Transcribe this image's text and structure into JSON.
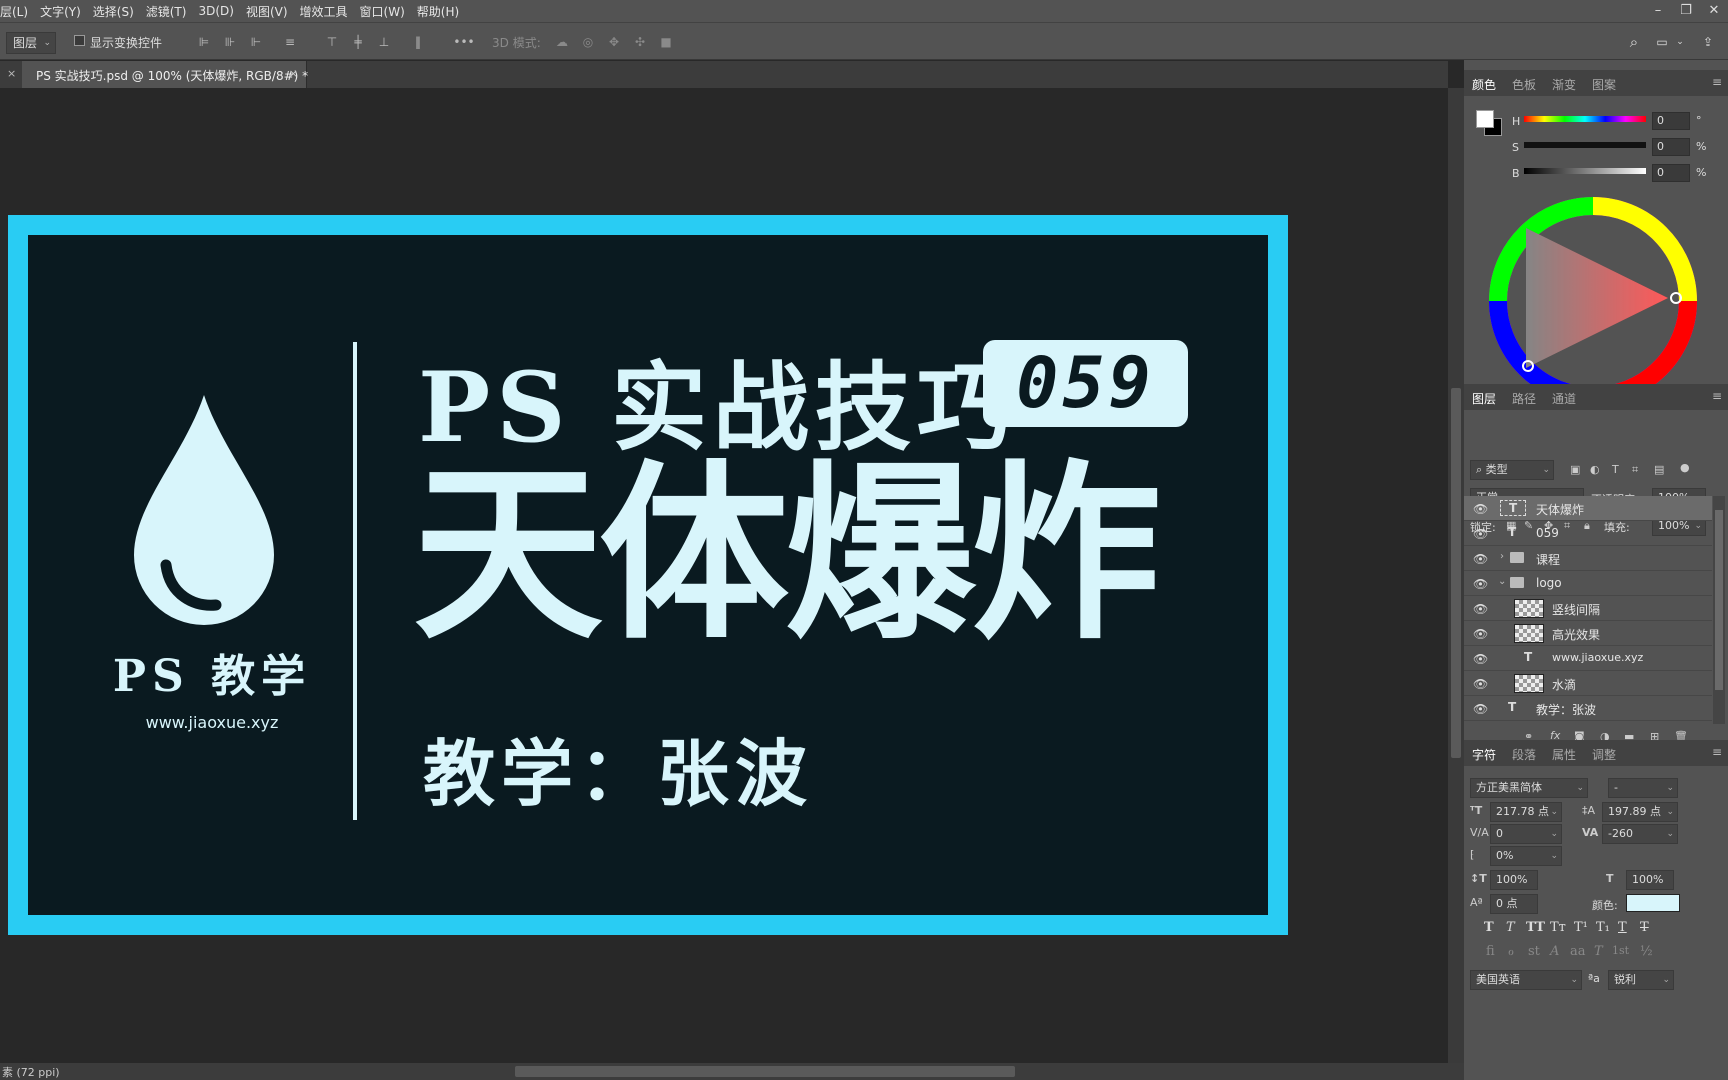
{
  "menu": [
    "层(L)",
    "文字(Y)",
    "选择(S)",
    "滤镜(T)",
    "3D(D)",
    "视图(V)",
    "增效工具",
    "窗口(W)",
    "帮助(H)"
  ],
  "window_controls": [
    "–",
    "❐",
    "✕"
  ],
  "options": {
    "layer_select": "图层",
    "show_transform": "显示变换控件",
    "mode_3d_label": "3D 模式:",
    "more": "•••"
  },
  "doc_tab": {
    "title": "PS 实战技巧.psd @ 100% (天体爆炸, RGB/8#) *",
    "close": "×"
  },
  "canvas": {
    "border_color": "#29ccf3",
    "bg_color": "#0a1a20",
    "text_color": "#d8f5fb",
    "logo_text": "PS 教学",
    "logo_url": "www.jiaoxue.xyz",
    "series_title": "PS 实战技巧",
    "episode": "059",
    "main_title": "天体爆炸",
    "teacher": "教学：张波"
  },
  "status": {
    "text": "素 (72 ppi)"
  },
  "color_panel": {
    "tabs": [
      "颜色",
      "色板",
      "渐变",
      "图案"
    ],
    "sliders": [
      {
        "label": "H",
        "value": "0",
        "unit": "°"
      },
      {
        "label": "S",
        "value": "0",
        "unit": "%"
      },
      {
        "label": "B",
        "value": "0",
        "unit": "%"
      }
    ]
  },
  "layers_panel": {
    "tabs": [
      "图层",
      "路径",
      "通道"
    ],
    "filter": "类型",
    "blend_mode": "正常",
    "opacity_label": "不透明度:",
    "opacity": "100%",
    "lock_label": "锁定:",
    "fill_label": "填充:",
    "fill": "100%",
    "layers": [
      {
        "name": "天体爆炸",
        "kind": "text",
        "selected": true,
        "indent": 0
      },
      {
        "name": "059",
        "kind": "text",
        "selected": false,
        "indent": 0
      },
      {
        "name": "课程",
        "kind": "folder",
        "expanded": false,
        "indent": 0
      },
      {
        "name": "logo",
        "kind": "folder",
        "expanded": true,
        "indent": 0
      },
      {
        "name": "竖线间隔",
        "kind": "smart",
        "indent": 1
      },
      {
        "name": "高光效果",
        "kind": "smart",
        "indent": 1
      },
      {
        "name": "www.jiaoxue.xyz",
        "kind": "text",
        "indent": 1
      },
      {
        "name": "水滴",
        "kind": "smart",
        "indent": 1
      },
      {
        "name": "教学：张波",
        "kind": "text",
        "indent": 0
      }
    ]
  },
  "char_panel": {
    "tabs": [
      "字符",
      "段落",
      "属性",
      "调整"
    ],
    "font_family": "方正美黑简体",
    "font_style": "-",
    "font_size": "217.78 点",
    "leading": "197.89 点",
    "kerning": "0",
    "tracking": "-260",
    "tsume": "0%",
    "vscale": "100%",
    "hscale": "100%",
    "baseline": "0 点",
    "color_label": "颜色:",
    "text_color": "#d8f5fb",
    "type_buttons": [
      "T",
      "T",
      "TT",
      "Tт",
      "T¹",
      "T₁",
      "T",
      "T"
    ],
    "ot_buttons": [
      "fi",
      "ℴ",
      "st",
      "A",
      "aa",
      "T",
      "1st",
      "½"
    ],
    "language": "美国英语",
    "aa_label": "ªa",
    "antialias": "锐利"
  }
}
